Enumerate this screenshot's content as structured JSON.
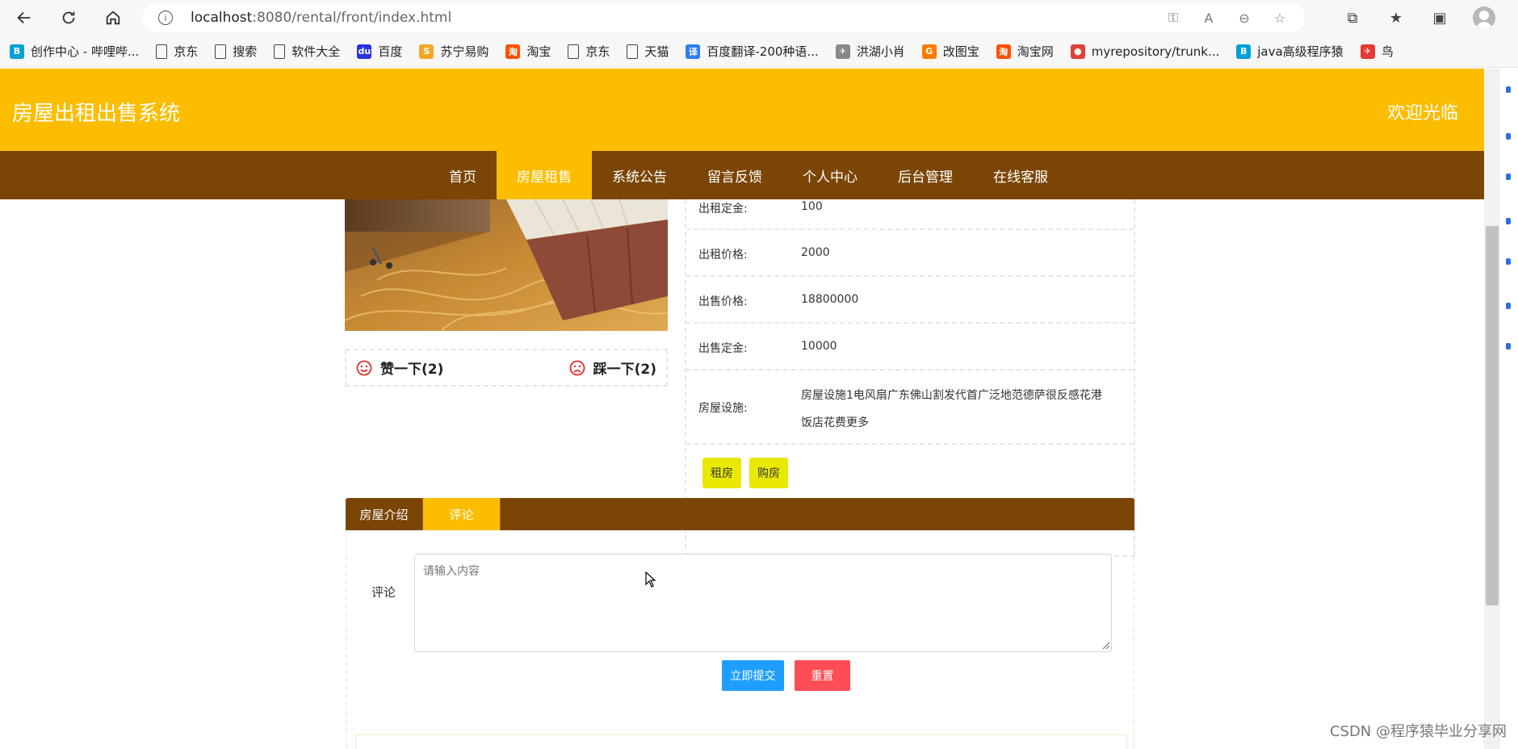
{
  "browser": {
    "url_host": "localhost",
    "url_rest": ":8080/rental/front/index.html",
    "bookmarks": [
      {
        "label": "创作中心 - 哔哩哔...",
        "icon": "bilibili-icon",
        "color": "#00a1d6",
        "glyph": "B"
      },
      {
        "label": "京东",
        "icon": "page-icon"
      },
      {
        "label": "搜索",
        "icon": "page-icon"
      },
      {
        "label": "软件大全",
        "icon": "page-icon"
      },
      {
        "label": "百度",
        "icon": "baidu-icon",
        "color": "#2932e1",
        "glyph": "du"
      },
      {
        "label": "苏宁易购",
        "icon": "suning-icon",
        "color": "#f5a623",
        "glyph": "S"
      },
      {
        "label": "淘宝",
        "icon": "taobao-icon",
        "color": "#ff5000",
        "glyph": "淘"
      },
      {
        "label": "京东",
        "icon": "page-icon"
      },
      {
        "label": "天猫",
        "icon": "page-icon"
      },
      {
        "label": "百度翻译-200种语...",
        "icon": "translate-icon",
        "color": "#2d7cf5",
        "glyph": "译"
      },
      {
        "label": "洪湖小肖",
        "icon": "bird-icon",
        "color": "#888",
        "glyph": "✈"
      },
      {
        "label": "改图宝",
        "icon": "gaitubao-icon",
        "color": "#ff7a00",
        "glyph": "G"
      },
      {
        "label": "淘宝网",
        "icon": "taobao-icon",
        "color": "#ff5000",
        "glyph": "淘"
      },
      {
        "label": "myrepository/trunk...",
        "icon": "chrome-icon",
        "color": "#db4437",
        "glyph": "●"
      },
      {
        "label": "java高级程序猿",
        "icon": "bilibili-icon",
        "color": "#00a1d6",
        "glyph": "B"
      },
      {
        "label": "鸟",
        "icon": "bird-icon",
        "color": "#e53935",
        "glyph": "✈"
      }
    ]
  },
  "site": {
    "title": "房屋出租出售系统",
    "welcome": "欢迎光临",
    "nav": [
      "首页",
      "房屋租售",
      "系统公告",
      "留言反馈",
      "个人中心",
      "后台管理",
      "在线客服"
    ],
    "active_nav_index": 1
  },
  "votes": {
    "like": "赞一下(2)",
    "dislike": "踩一下(2)"
  },
  "details": {
    "rows": [
      {
        "label": "出租定金:",
        "value": "100"
      },
      {
        "label": "出租价格:",
        "value": "2000"
      },
      {
        "label": "出售价格:",
        "value": "18800000"
      },
      {
        "label": "出售定金:",
        "value": "10000"
      },
      {
        "label": "房屋设施:",
        "value_line1": "房屋设施1电风扇广东佛山割发代首广泛地范德萨很反感花港",
        "value_line2": "饭店花费更多"
      }
    ],
    "rent_button": "租房",
    "buy_button": "购房"
  },
  "tabs": {
    "items": [
      "房屋介绍",
      "评论"
    ],
    "active_index": 1
  },
  "comment": {
    "label": "评论",
    "placeholder": "请输入内容",
    "submit": "立即提交",
    "reset": "重置"
  },
  "watermark": "CSDN @程序猿毕业分享网",
  "colors": {
    "header": "#fcbd00",
    "nav": "#7b4506",
    "submit": "#1e9fff",
    "reset": "#ff4d55",
    "action_button": "#e8e800"
  }
}
